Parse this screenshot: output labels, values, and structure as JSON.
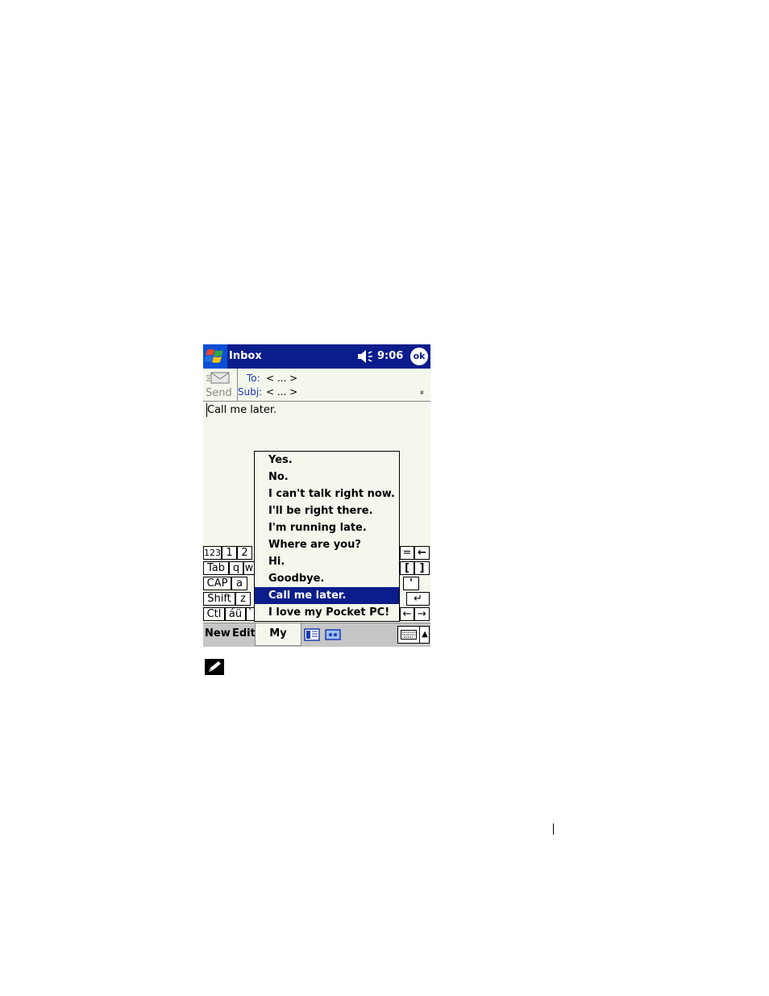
{
  "titlebar": {
    "title": "Inbox",
    "time": "9:06",
    "ok_label": "ok"
  },
  "header": {
    "send_label": "Send",
    "to_label": "To:",
    "to_value": "< ... >",
    "subj_label": "Subj:",
    "subj_value": "< ... >",
    "expand_glyph": "»"
  },
  "body": {
    "text": "Call me later."
  },
  "keyboard": {
    "rows": [
      [
        "123",
        "1",
        "2",
        "=",
        "←"
      ],
      [
        "Tab",
        "q",
        "w",
        "[",
        "]"
      ],
      [
        "CAP",
        "a",
        "'"
      ],
      [
        "Shift",
        "z",
        "↵"
      ],
      [
        "Ctl",
        "áü",
        "`",
        "←",
        "→"
      ]
    ]
  },
  "menubar": {
    "new_label": "New",
    "edit_label": "Edit",
    "mytext_label": "My Text"
  },
  "popup": {
    "items": [
      "Yes.",
      "No.",
      "I can't talk right now.",
      "I'll be right there.",
      "I'm running late.",
      "Where are you?",
      "Hi.",
      "Goodbye.",
      "Call me later.",
      "I love my Pocket PC!"
    ],
    "selected_index": 8
  },
  "colors": {
    "title_bg": "#0b1d8c",
    "selection_bg": "#0b1d8c",
    "screen_bg": "#f3f7ec",
    "label_blue": "#1a3bb0"
  }
}
